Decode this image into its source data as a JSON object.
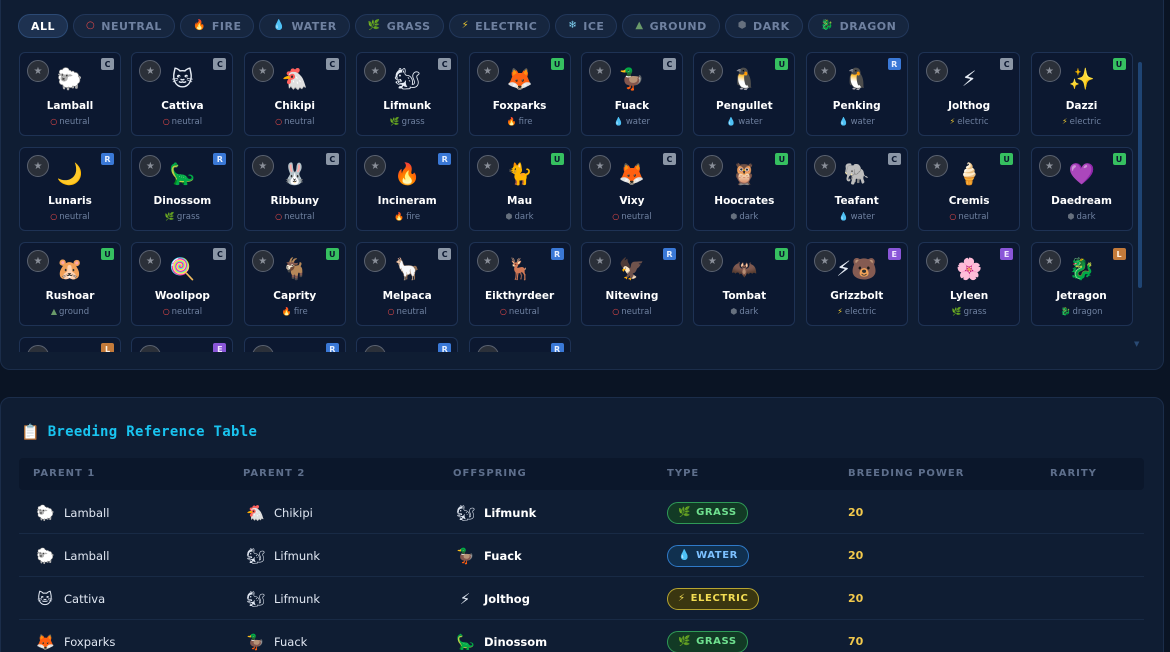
{
  "filters": [
    {
      "label": "ALL",
      "icon": "",
      "icon_name": "",
      "active": true
    },
    {
      "label": "NEUTRAL",
      "icon": "○",
      "icon_name": "neutral-icon",
      "color": "#e04848"
    },
    {
      "label": "FIRE",
      "icon": "🔥",
      "icon_name": "fire-icon",
      "color": "#f07a2a"
    },
    {
      "label": "WATER",
      "icon": "💧",
      "icon_name": "water-icon",
      "color": "#2f9be0"
    },
    {
      "label": "GRASS",
      "icon": "🌿",
      "icon_name": "grass-icon",
      "color": "#38b060"
    },
    {
      "label": "ELECTRIC",
      "icon": "⚡",
      "icon_name": "electric-icon",
      "color": "#e8c530"
    },
    {
      "label": "ICE",
      "icon": "❄",
      "icon_name": "ice-icon",
      "color": "#7fd0f0"
    },
    {
      "label": "GROUND",
      "icon": "▲",
      "icon_name": "ground-icon",
      "color": "#6a9a6a"
    },
    {
      "label": "DARK",
      "icon": "⬢",
      "icon_name": "dark-icon",
      "color": "#66707e"
    },
    {
      "label": "DRAGON",
      "icon": "🐉",
      "icon_name": "dragon-icon",
      "color": "#9a7a3a"
    }
  ],
  "types": {
    "neutral": {
      "icon": "○",
      "color": "#e04848"
    },
    "fire": {
      "icon": "🔥",
      "color": "#f07a2a"
    },
    "water": {
      "icon": "💧",
      "color": "#2f9be0"
    },
    "grass": {
      "icon": "🌿",
      "color": "#38b060"
    },
    "electric": {
      "icon": "⚡",
      "color": "#e8c530"
    },
    "ground": {
      "icon": "▲",
      "color": "#6a9a6a"
    },
    "dark": {
      "icon": "⬢",
      "color": "#66707e"
    },
    "dragon": {
      "icon": "🐉",
      "color": "#9a7a3a"
    }
  },
  "pals": [
    {
      "name": "Lamball",
      "type": "neutral",
      "rarity": "C",
      "sprite": "🐑"
    },
    {
      "name": "Cattiva",
      "type": "neutral",
      "rarity": "C",
      "sprite": "🐱"
    },
    {
      "name": "Chikipi",
      "type": "neutral",
      "rarity": "C",
      "sprite": "🐔"
    },
    {
      "name": "Lifmunk",
      "type": "grass",
      "rarity": "C",
      "sprite": "🐿"
    },
    {
      "name": "Foxparks",
      "type": "fire",
      "rarity": "U",
      "sprite": "🦊"
    },
    {
      "name": "Fuack",
      "type": "water",
      "rarity": "C",
      "sprite": "🦆"
    },
    {
      "name": "Pengullet",
      "type": "water",
      "rarity": "U",
      "sprite": "🐧"
    },
    {
      "name": "Penking",
      "type": "water",
      "rarity": "R",
      "sprite": "🐧"
    },
    {
      "name": "Jolthog",
      "type": "electric",
      "rarity": "C",
      "sprite": "⚡"
    },
    {
      "name": "Dazzi",
      "type": "electric",
      "rarity": "U",
      "sprite": "✨"
    },
    {
      "name": "Lunaris",
      "type": "neutral",
      "rarity": "R",
      "sprite": "🌙"
    },
    {
      "name": "Dinossom",
      "type": "grass",
      "rarity": "R",
      "sprite": "🦕"
    },
    {
      "name": "Ribbuny",
      "type": "neutral",
      "rarity": "C",
      "sprite": "🐰"
    },
    {
      "name": "Incineram",
      "type": "fire",
      "rarity": "R",
      "sprite": "🔥"
    },
    {
      "name": "Mau",
      "type": "dark",
      "rarity": "U",
      "sprite": "🐈"
    },
    {
      "name": "Vixy",
      "type": "neutral",
      "rarity": "C",
      "sprite": "🦊"
    },
    {
      "name": "Hoocrates",
      "type": "dark",
      "rarity": "U",
      "sprite": "🦉"
    },
    {
      "name": "Teafant",
      "type": "water",
      "rarity": "C",
      "sprite": "🐘"
    },
    {
      "name": "Cremis",
      "type": "neutral",
      "rarity": "U",
      "sprite": "🍦"
    },
    {
      "name": "Daedream",
      "type": "dark",
      "rarity": "U",
      "sprite": "💜"
    },
    {
      "name": "Rushoar",
      "type": "ground",
      "rarity": "U",
      "sprite": "🐹"
    },
    {
      "name": "Woolipop",
      "type": "neutral",
      "rarity": "C",
      "sprite": "🍭"
    },
    {
      "name": "Caprity",
      "type": "fire",
      "rarity": "U",
      "sprite": "🐐"
    },
    {
      "name": "Melpaca",
      "type": "neutral",
      "rarity": "C",
      "sprite": "🦙"
    },
    {
      "name": "Eikthyrdeer",
      "type": "neutral",
      "rarity": "R",
      "sprite": "🦌"
    },
    {
      "name": "Nitewing",
      "type": "neutral",
      "rarity": "R",
      "sprite": "🦅"
    },
    {
      "name": "Tombat",
      "type": "dark",
      "rarity": "U",
      "sprite": "🦇"
    },
    {
      "name": "Grizzbolt",
      "type": "electric",
      "rarity": "E",
      "sprite": "⚡🐻"
    },
    {
      "name": "Lyleen",
      "type": "grass",
      "rarity": "E",
      "sprite": "🌸"
    },
    {
      "name": "Jetragon",
      "type": "dragon",
      "rarity": "L",
      "sprite": "🐉"
    },
    {
      "name": "",
      "type": "",
      "rarity": "L",
      "sprite": ""
    },
    {
      "name": "",
      "type": "",
      "rarity": "E",
      "sprite": ""
    },
    {
      "name": "",
      "type": "",
      "rarity": "R",
      "sprite": ""
    },
    {
      "name": "",
      "type": "",
      "rarity": "R",
      "sprite": ""
    },
    {
      "name": "",
      "type": "",
      "rarity": "R",
      "sprite": ""
    }
  ],
  "breeding": {
    "title": "Breeding Reference Table",
    "title_icon": "📋",
    "columns": [
      "PARENT 1",
      "PARENT 2",
      "OFFSPRING",
      "TYPE",
      "BREEDING POWER",
      "RARITY"
    ],
    "rows": [
      {
        "p1": "Lamball",
        "p1_icon": "🐑",
        "p2": "Chikipi",
        "p2_icon": "🐔",
        "off": "Lifmunk",
        "off_icon": "🐿",
        "type": "GRASS",
        "type_key": "grass",
        "type_icon": "🌿",
        "power": "20",
        "rarity": ""
      },
      {
        "p1": "Lamball",
        "p1_icon": "🐑",
        "p2": "Lifmunk",
        "p2_icon": "🐿",
        "off": "Fuack",
        "off_icon": "🦆",
        "type": "WATER",
        "type_key": "water",
        "type_icon": "💧",
        "power": "20",
        "rarity": ""
      },
      {
        "p1": "Cattiva",
        "p1_icon": "🐱",
        "p2": "Lifmunk",
        "p2_icon": "🐿",
        "off": "Jolthog",
        "off_icon": "⚡",
        "type": "ELECTRIC",
        "type_key": "electric",
        "type_icon": "⚡",
        "power": "20",
        "rarity": ""
      },
      {
        "p1": "Foxparks",
        "p1_icon": "🦊",
        "p2": "Fuack",
        "p2_icon": "🦆",
        "off": "Dinossom",
        "off_icon": "🦕",
        "type": "GRASS",
        "type_key": "grass",
        "type_icon": "🌿",
        "power": "70",
        "rarity": ""
      }
    ]
  }
}
